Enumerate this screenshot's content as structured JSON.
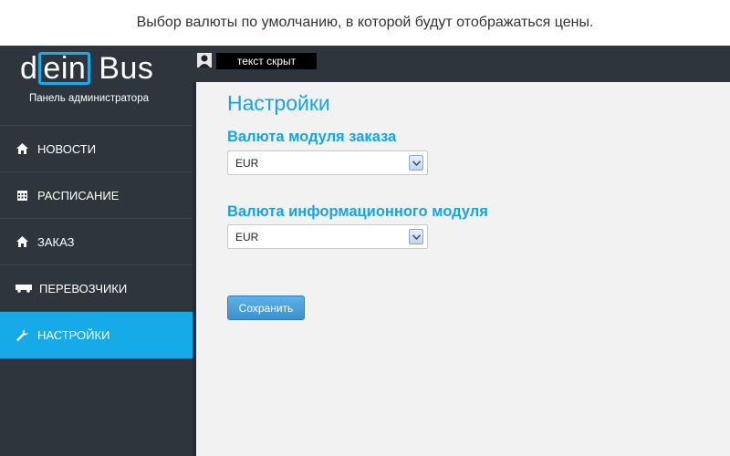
{
  "caption": "Выбор валюты по умолчанию, в которой будут отображаться цены.",
  "logo": {
    "part1": "d",
    "part2": "ein",
    "part3": "Bus"
  },
  "sidebar": {
    "subtitle": "Панель администратора",
    "items": [
      {
        "label": "НОВОСТИ",
        "icon": "home-icon",
        "active": false
      },
      {
        "label": "РАСПИСАНИЕ",
        "icon": "calendar-icon",
        "active": false
      },
      {
        "label": "ЗАКАЗ",
        "icon": "home-icon",
        "active": false
      },
      {
        "label": "ПЕРЕВОЗЧИКИ",
        "icon": "truck-icon",
        "active": false
      },
      {
        "label": "НАСТРОЙКИ",
        "icon": "wrench-icon",
        "active": true
      }
    ]
  },
  "topbar": {
    "user_name": "текст скрыт"
  },
  "main": {
    "title": "Настройки",
    "order_currency_label": "Валюта модуля заказа",
    "order_currency_value": "EUR",
    "info_currency_label": "Валюта информационного модуля",
    "info_currency_value": "EUR",
    "save_label": "Сохранить"
  },
  "colors": {
    "accent": "#16aae8",
    "sidebar_bg": "#2f353d",
    "content_bg": "#f2f2f2"
  }
}
